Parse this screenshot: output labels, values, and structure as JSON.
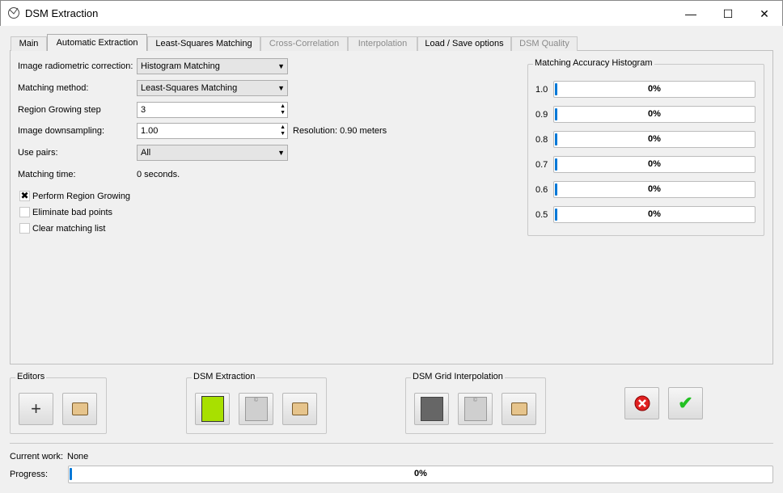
{
  "window": {
    "title": "DSM Extraction",
    "controls": [
      "minimize",
      "maximize",
      "close"
    ]
  },
  "tabs": [
    {
      "label": "Main",
      "state": "normal"
    },
    {
      "label": "Automatic Extraction",
      "state": "active"
    },
    {
      "label": "Least-Squares Matching",
      "state": "normal"
    },
    {
      "label": "Cross-Correlation",
      "state": "disabled"
    },
    {
      "label": "Interpolation",
      "state": "disabled"
    },
    {
      "label": "Load / Save options",
      "state": "normal"
    },
    {
      "label": "DSM Quality",
      "state": "disabled"
    }
  ],
  "form": {
    "radiometric": {
      "label": "Image radiometric correction:",
      "value": "Histogram Matching"
    },
    "method": {
      "label": "Matching method:",
      "value": "Least-Squares Matching"
    },
    "region_step": {
      "label": "Region Growing step",
      "value": "3"
    },
    "downsampling": {
      "label": "Image downsampling:",
      "value": "1.00",
      "resolution": "Resolution:  0.90 meters"
    },
    "pairs": {
      "label": "Use pairs:",
      "value": "All"
    },
    "matching_time": {
      "label": "Matching time:",
      "value": "0 seconds."
    },
    "checkboxes": [
      {
        "label": "Perform Region Growing",
        "checked": true
      },
      {
        "label": "Eliminate bad points",
        "checked": false
      },
      {
        "label": "Clear matching list",
        "checked": false
      }
    ]
  },
  "histogram": {
    "title": "Matching Accuracy Histogram",
    "rows": [
      {
        "label": "1.0",
        "value": "0%",
        "percent": 0
      },
      {
        "label": "0.9",
        "value": "0%",
        "percent": 0
      },
      {
        "label": "0.8",
        "value": "0%",
        "percent": 0
      },
      {
        "label": "0.7",
        "value": "0%",
        "percent": 0
      },
      {
        "label": "0.6",
        "value": "0%",
        "percent": 0
      },
      {
        "label": "0.5",
        "value": "0%",
        "percent": 0
      }
    ]
  },
  "groups": {
    "editors": "Editors",
    "dsm_extraction": "DSM Extraction",
    "dsm_grid": "DSM Grid Interpolation"
  },
  "status": {
    "current_label": "Current work:",
    "current_value": "None",
    "progress_label": "Progress:",
    "progress_value": "0%",
    "progress_percent": 0
  },
  "colors": {
    "accent": "#0078d7",
    "cancel": "#e02020",
    "ok": "#22c022"
  }
}
